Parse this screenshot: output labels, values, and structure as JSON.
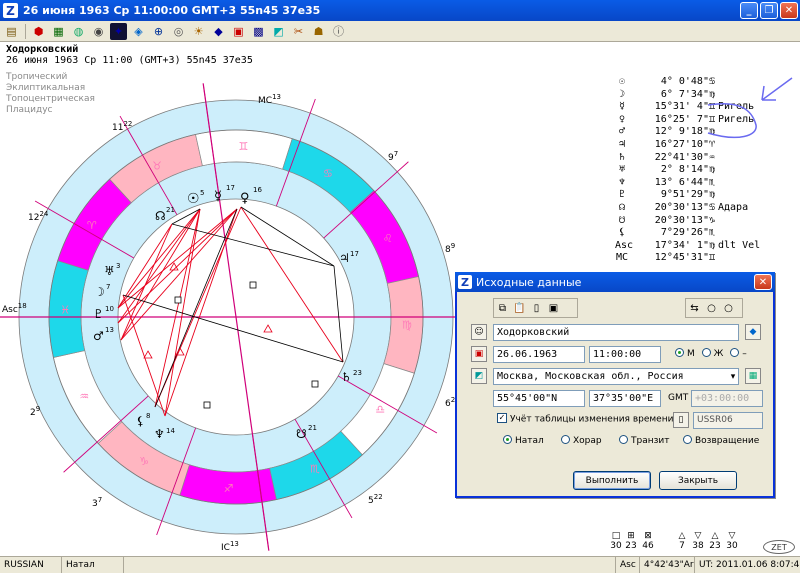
{
  "window": {
    "title": "26 июня 1963  Ср  11:00:00 GMT+3 55n45  37e35",
    "app_letter": "Z"
  },
  "toolbar_icons": [
    "open-icon",
    "print-icon",
    "chart-icon",
    "globe-icon",
    "wheel-icon",
    "night-sky-icon",
    "eye-icon",
    "planets-icon",
    "ring-icon",
    "sun-icon",
    "book-icon",
    "calendar-icon",
    "grid-icon",
    "aspect-icon",
    "tools-icon",
    "people-icon",
    "info-icon"
  ],
  "header": {
    "name": "Ходорковский",
    "date": "26 июня 1963  Ср  11:00 (GMT+3) 55n45  37e35",
    "options": [
      "Тропический",
      "Эклиптикальная",
      "Топоцентрическая",
      "Плацидус"
    ]
  },
  "chart": {
    "house_labels": [
      {
        "text": "MC",
        "sup": "13"
      },
      {
        "text": "9",
        "sup": "7"
      },
      {
        "text": "8",
        "sup": "9"
      },
      {
        "text": "7",
        "sup": ""
      },
      {
        "text": "6",
        "sup": "24"
      },
      {
        "text": "5",
        "sup": "22"
      },
      {
        "text": "IC",
        "sup": "13"
      },
      {
        "text": "3",
        "sup": "7"
      },
      {
        "text": "2",
        "sup": "9"
      },
      {
        "text": "Asc",
        "sup": "18"
      },
      {
        "text": "12",
        "sup": "24"
      },
      {
        "text": "11",
        "sup": "22"
      }
    ],
    "planet_degrees": [
      "5",
      "17",
      "16",
      "21",
      "3",
      "7",
      "10",
      "13",
      "14",
      "8",
      "17",
      "23",
      "21"
    ],
    "colors": {
      "ring": "#cdeefb",
      "fire": "#ff00ff",
      "earth": "#ffb6c1",
      "air": "#ffffff",
      "water": "#1ed8ea",
      "aspect_red": "#e8001c",
      "aspect_black": "#000000",
      "house_line": "#d0007a"
    }
  },
  "planets": [
    {
      "glyph": "☉",
      "pos": "4° 0'48\"♋",
      "note": ""
    },
    {
      "glyph": "☽",
      "pos": "6° 7'34\"♍",
      "note": ""
    },
    {
      "glyph": "☿",
      "pos": "15°31' 4\"♊",
      "note": "Ригель"
    },
    {
      "glyph": "♀",
      "pos": "16°25' 7\"♊",
      "note": "Ригель"
    },
    {
      "glyph": "♂",
      "pos": "12° 9'18\"♍",
      "note": ""
    },
    {
      "glyph": "♃",
      "pos": "16°27'10\"♈",
      "note": ""
    },
    {
      "glyph": "♄",
      "pos": "22°41'30\"♒",
      "note": ""
    },
    {
      "glyph": "♅",
      "pos": "2° 8'14\"♍",
      "note": ""
    },
    {
      "glyph": "♆",
      "pos": "13° 6'44\"♏",
      "note": ""
    },
    {
      "glyph": "♇",
      "pos": "9°51'29\"♍",
      "note": ""
    },
    {
      "glyph": "☊",
      "pos": "20°30'13\"♋",
      "note": "Адара"
    },
    {
      "glyph": "☋",
      "pos": "20°30'13\"♑",
      "note": ""
    },
    {
      "glyph": "⚸",
      "pos": "7°29'26\"♏",
      "note": ""
    },
    {
      "glyph": "Asc",
      "pos": "17°34' 1\"♍",
      "note": "dlt Vel"
    },
    {
      "glyph": "MC",
      "pos": "12°45'31\"♊",
      "note": ""
    }
  ],
  "bottom_totals": [
    {
      "icon": "□",
      "value": "30"
    },
    {
      "icon": "⊞",
      "value": "23"
    },
    {
      "icon": "⊠",
      "value": "46"
    },
    {
      "icon": "△",
      "value": "7"
    },
    {
      "icon": "▽",
      "value": "38"
    },
    {
      "icon": "△",
      "value": "23"
    },
    {
      "icon": "▽",
      "value": "30"
    }
  ],
  "zet_label": "ZET",
  "statusbar": {
    "language": "RUSSIAN",
    "mode": "Натал",
    "asc": "Asc",
    "asc_value": "4°42'43\"Ari",
    "ut": "UT: 2011.01.06  8:07:47"
  },
  "dialog": {
    "title": "Исходные данные",
    "name_value": "Ходорковский",
    "date_value": "26.06.1963",
    "time_value": "11:00:00",
    "sex_options": [
      "М",
      "Ж",
      "–"
    ],
    "place_value": "Москва, Московская обл., Россия",
    "lat_value": "55°45'00\"N",
    "lon_value": "37°35'00\"E",
    "gmt_label": "GMT",
    "gmt_value": "+03:00:00",
    "dst_label": "Учёт таблицы изменения времени",
    "dst_table": "USSR06",
    "chart_types": [
      "Натал",
      "Хорар",
      "Транзит",
      "Возвращение"
    ],
    "ok_label": "Выполнить",
    "close_label": "Закрыть"
  }
}
